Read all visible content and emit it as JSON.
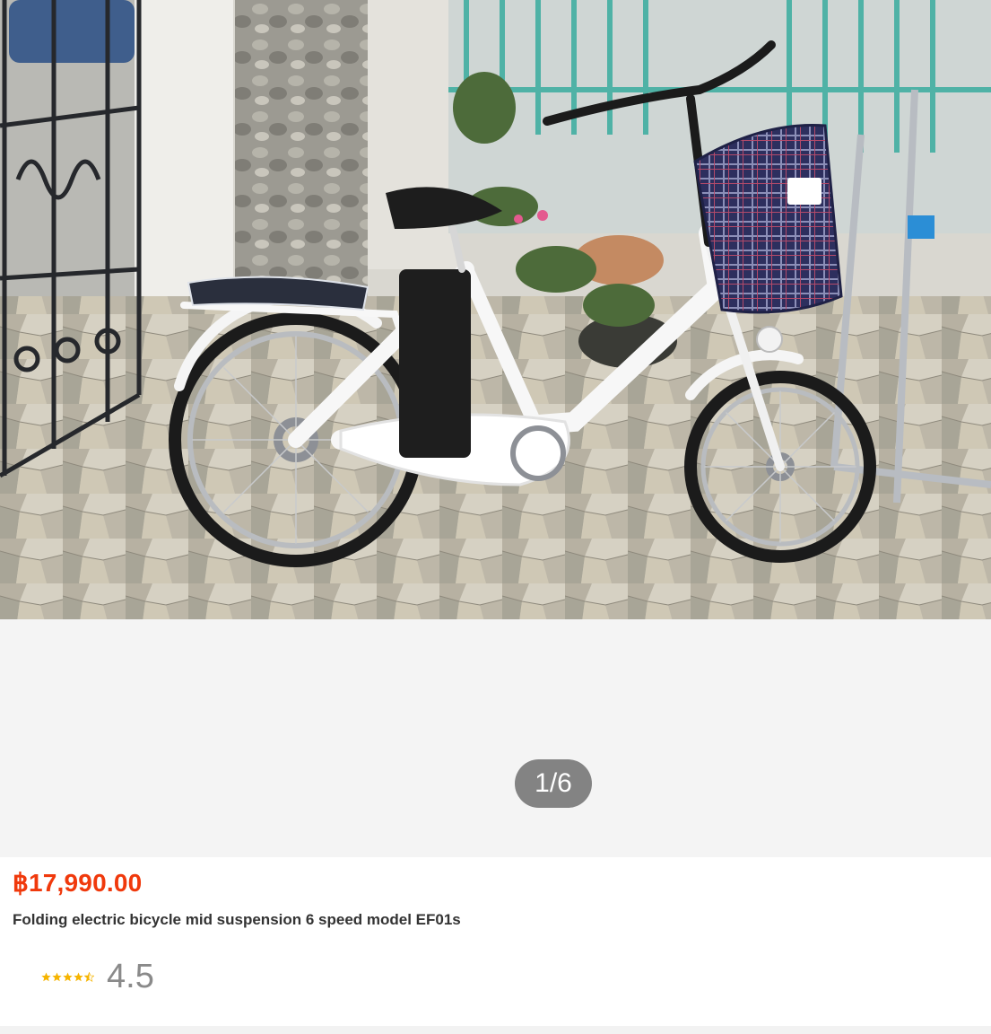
{
  "gallery": {
    "image_alt": "Folding electric bicycle with basket",
    "counter": "1/6"
  },
  "product": {
    "price": "฿17,990.00",
    "title": "Folding electric bicycle mid suspension 6 speed model EF01s",
    "rating": {
      "value": "4.5",
      "stars": 4.5
    }
  },
  "colors": {
    "price": "#f0390c",
    "star": "#f6b400",
    "counter_bg": "#6e6e6e"
  },
  "icons": {
    "star": "star-icon",
    "half_star": "half-star-icon"
  }
}
